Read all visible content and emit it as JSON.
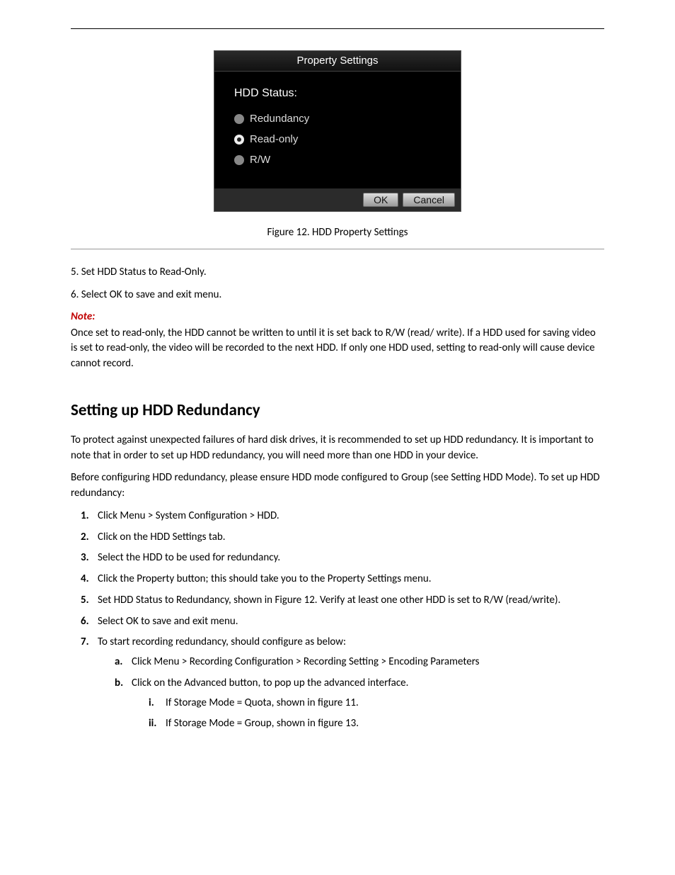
{
  "dialog": {
    "title": "Property Settings",
    "status_label": "HDD Status:",
    "options": {
      "redundancy": "Redundancy",
      "read_only": "Read-only",
      "rw": "R/W"
    },
    "buttons": {
      "ok": "OK",
      "cancel": "Cancel"
    }
  },
  "figure_caption": "Figure 12. HDD Property Settings",
  "step5": "5.  Set HDD Status to Read-Only.",
  "step6": "6.  Select OK to save and exit menu.",
  "note_label": "Note:",
  "note_text": "Once set to read-only, the HDD cannot be written to until it is set back to R/W (read/ write). If a HDD used for saving video is set to read-only, the video will be recorded to the next HDD. If only one HDD used, setting to read-only will cause device cannot record.",
  "heading_redundancy": "Setting up HDD Redundancy",
  "redundancy_intro": "To protect against unexpected failures of hard disk drives, it is recommended to set up HDD redundancy. It is important to note that in order to set up HDD redundancy, you will need more than one HDD in your device.",
  "redundancy_before": "Before configuring HDD redundancy, please ensure HDD mode configured to Group (see Setting HDD Mode). To set up HDD redundancy:",
  "redundancy_steps": {
    "s1": "Click Menu > System Configuration > HDD.",
    "s2": "Click on the HDD Settings tab.",
    "s3": "Select the HDD to be used for redundancy.",
    "s4": "Click the Property button; this should take you to the Property Settings menu.",
    "s5": "Set HDD Status to Redundancy, shown in Figure 12. Verify at least one other HDD is set to R/W (read/write).",
    "s6": "Select OK to save and exit menu.",
    "s7": "To start recording redundancy, should configure as below:",
    "s7a": "Click Menu > Recording Configuration > Recording Setting > Encoding Parameters",
    "s7b": "Click on the Advanced button, to pop up the advanced interface.",
    "s7i": "If Storage Mode = Quota, shown in figure 11.",
    "s7ii": "If Storage Mode = Group, shown in figure 13."
  }
}
